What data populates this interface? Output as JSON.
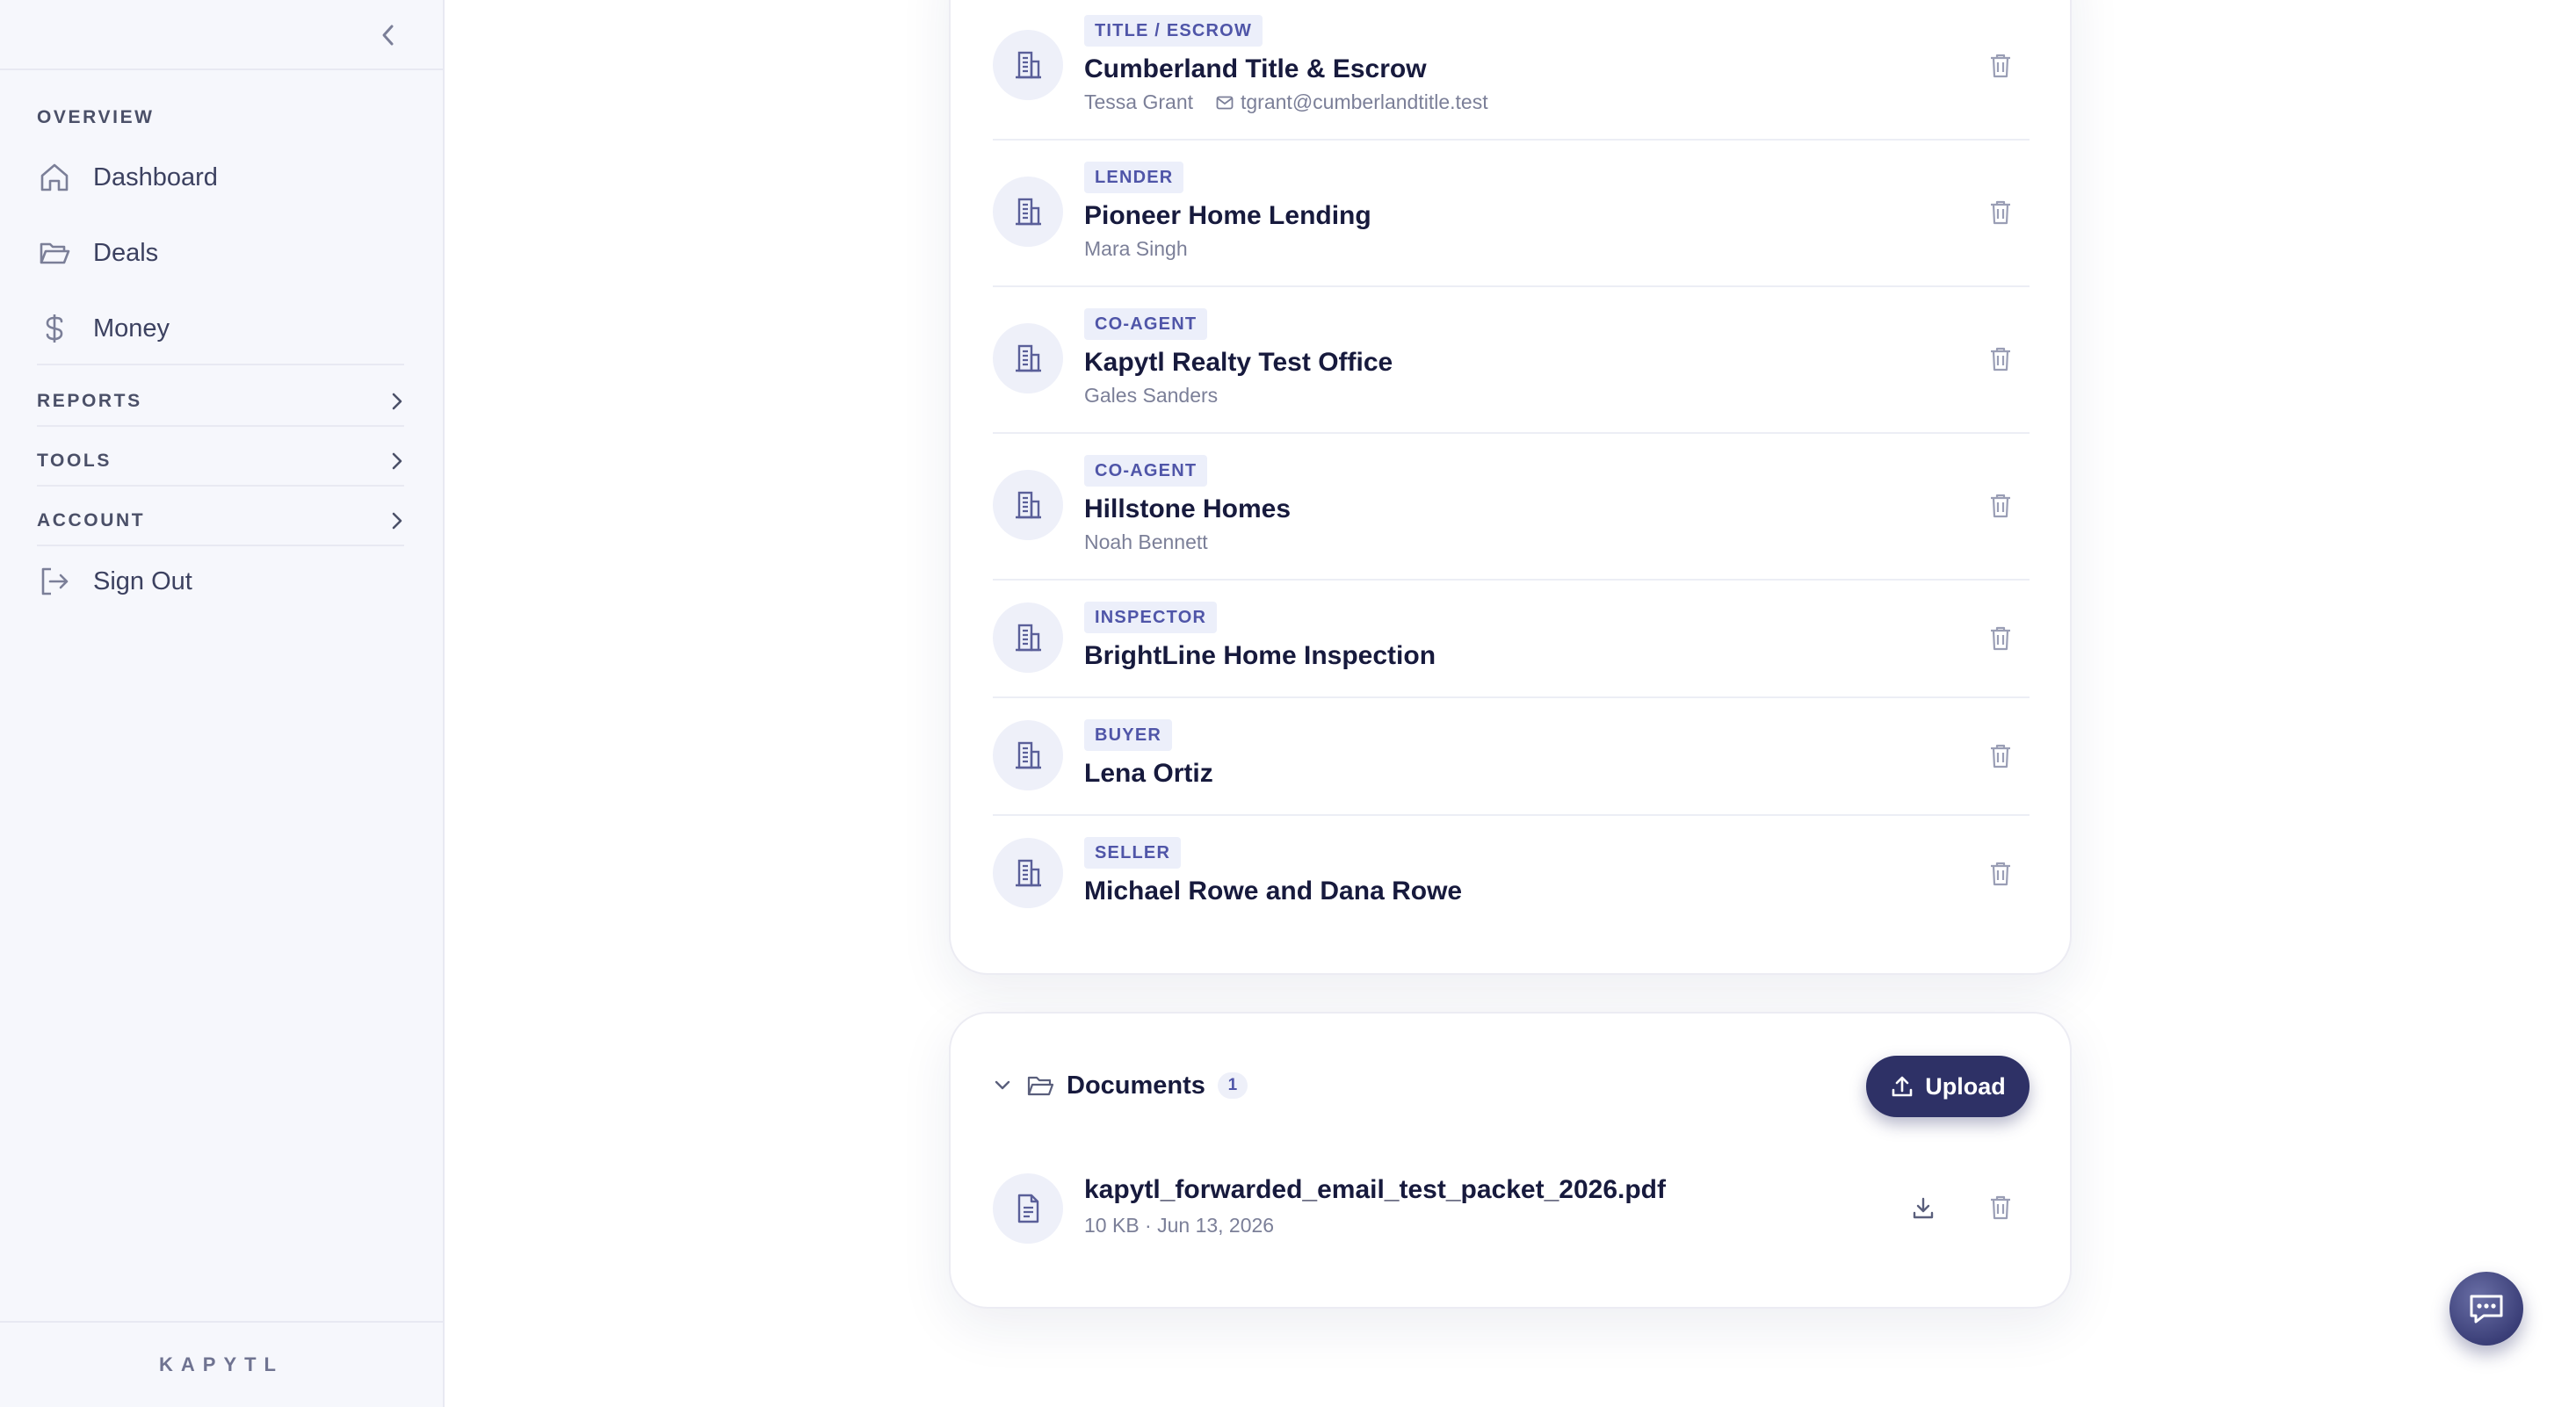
{
  "sidebar": {
    "overview_label": "OVERVIEW",
    "nav": {
      "dashboard": "Dashboard",
      "deals": "Deals",
      "money": "Money"
    },
    "groups": {
      "reports": "REPORTS",
      "tools": "TOOLS",
      "account": "ACCOUNT"
    },
    "sign_out": "Sign Out",
    "brand": "KAPYTL"
  },
  "parties": [
    {
      "role": "TITLE / ESCROW",
      "name": "Cumberland Title & Escrow",
      "contact": "Tessa Grant",
      "email": "tgrant@cumberlandtitle.test"
    },
    {
      "role": "LENDER",
      "name": "Pioneer Home Lending",
      "contact": "Mara Singh"
    },
    {
      "role": "CO-AGENT",
      "name": "Kapytl Realty Test Office",
      "contact": "Gales Sanders"
    },
    {
      "role": "CO-AGENT",
      "name": "Hillstone Homes",
      "contact": "Noah Bennett"
    },
    {
      "role": "INSPECTOR",
      "name": "BrightLine Home Inspection"
    },
    {
      "role": "BUYER",
      "name": "Lena Ortiz"
    },
    {
      "role": "SELLER",
      "name": "Michael Rowe and Dana Rowe"
    }
  ],
  "documents": {
    "title": "Documents",
    "count": "1",
    "upload_label": "Upload",
    "files": [
      {
        "name": "kapytl_forwarded_email_test_packet_2026.pdf",
        "meta": "10 KB · Jun 13, 2026"
      }
    ]
  },
  "colors": {
    "accent": "#2e3166",
    "badge_bg": "#eceffa",
    "badge_text": "#4f55a8",
    "sidebar_bg": "#f6f7fc"
  }
}
